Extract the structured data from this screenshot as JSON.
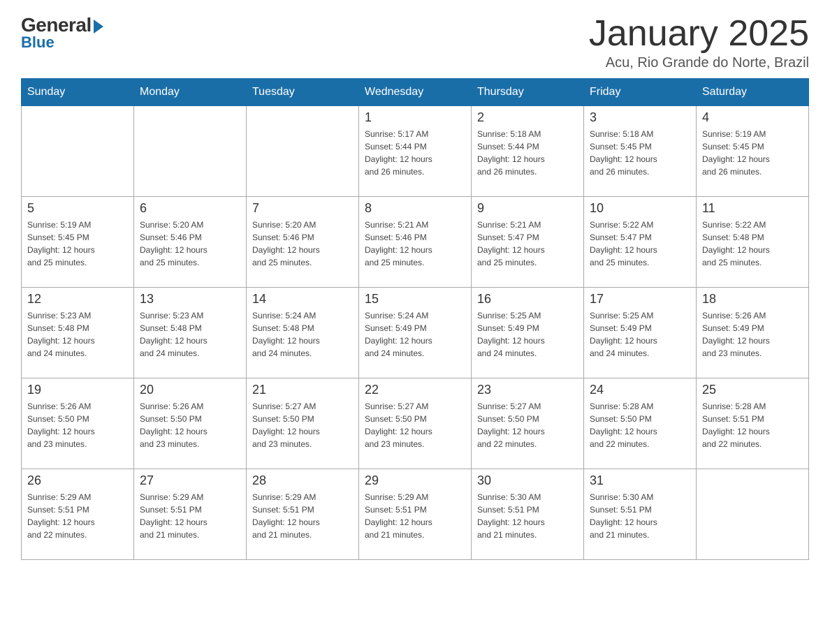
{
  "logo": {
    "general": "General",
    "blue": "Blue"
  },
  "header": {
    "month": "January 2025",
    "location": "Acu, Rio Grande do Norte, Brazil"
  },
  "days_of_week": [
    "Sunday",
    "Monday",
    "Tuesday",
    "Wednesday",
    "Thursday",
    "Friday",
    "Saturday"
  ],
  "weeks": [
    [
      {
        "day": "",
        "info": ""
      },
      {
        "day": "",
        "info": ""
      },
      {
        "day": "",
        "info": ""
      },
      {
        "day": "1",
        "info": "Sunrise: 5:17 AM\nSunset: 5:44 PM\nDaylight: 12 hours\nand 26 minutes."
      },
      {
        "day": "2",
        "info": "Sunrise: 5:18 AM\nSunset: 5:44 PM\nDaylight: 12 hours\nand 26 minutes."
      },
      {
        "day": "3",
        "info": "Sunrise: 5:18 AM\nSunset: 5:45 PM\nDaylight: 12 hours\nand 26 minutes."
      },
      {
        "day": "4",
        "info": "Sunrise: 5:19 AM\nSunset: 5:45 PM\nDaylight: 12 hours\nand 26 minutes."
      }
    ],
    [
      {
        "day": "5",
        "info": "Sunrise: 5:19 AM\nSunset: 5:45 PM\nDaylight: 12 hours\nand 25 minutes."
      },
      {
        "day": "6",
        "info": "Sunrise: 5:20 AM\nSunset: 5:46 PM\nDaylight: 12 hours\nand 25 minutes."
      },
      {
        "day": "7",
        "info": "Sunrise: 5:20 AM\nSunset: 5:46 PM\nDaylight: 12 hours\nand 25 minutes."
      },
      {
        "day": "8",
        "info": "Sunrise: 5:21 AM\nSunset: 5:46 PM\nDaylight: 12 hours\nand 25 minutes."
      },
      {
        "day": "9",
        "info": "Sunrise: 5:21 AM\nSunset: 5:47 PM\nDaylight: 12 hours\nand 25 minutes."
      },
      {
        "day": "10",
        "info": "Sunrise: 5:22 AM\nSunset: 5:47 PM\nDaylight: 12 hours\nand 25 minutes."
      },
      {
        "day": "11",
        "info": "Sunrise: 5:22 AM\nSunset: 5:48 PM\nDaylight: 12 hours\nand 25 minutes."
      }
    ],
    [
      {
        "day": "12",
        "info": "Sunrise: 5:23 AM\nSunset: 5:48 PM\nDaylight: 12 hours\nand 24 minutes."
      },
      {
        "day": "13",
        "info": "Sunrise: 5:23 AM\nSunset: 5:48 PM\nDaylight: 12 hours\nand 24 minutes."
      },
      {
        "day": "14",
        "info": "Sunrise: 5:24 AM\nSunset: 5:48 PM\nDaylight: 12 hours\nand 24 minutes."
      },
      {
        "day": "15",
        "info": "Sunrise: 5:24 AM\nSunset: 5:49 PM\nDaylight: 12 hours\nand 24 minutes."
      },
      {
        "day": "16",
        "info": "Sunrise: 5:25 AM\nSunset: 5:49 PM\nDaylight: 12 hours\nand 24 minutes."
      },
      {
        "day": "17",
        "info": "Sunrise: 5:25 AM\nSunset: 5:49 PM\nDaylight: 12 hours\nand 24 minutes."
      },
      {
        "day": "18",
        "info": "Sunrise: 5:26 AM\nSunset: 5:49 PM\nDaylight: 12 hours\nand 23 minutes."
      }
    ],
    [
      {
        "day": "19",
        "info": "Sunrise: 5:26 AM\nSunset: 5:50 PM\nDaylight: 12 hours\nand 23 minutes."
      },
      {
        "day": "20",
        "info": "Sunrise: 5:26 AM\nSunset: 5:50 PM\nDaylight: 12 hours\nand 23 minutes."
      },
      {
        "day": "21",
        "info": "Sunrise: 5:27 AM\nSunset: 5:50 PM\nDaylight: 12 hours\nand 23 minutes."
      },
      {
        "day": "22",
        "info": "Sunrise: 5:27 AM\nSunset: 5:50 PM\nDaylight: 12 hours\nand 23 minutes."
      },
      {
        "day": "23",
        "info": "Sunrise: 5:27 AM\nSunset: 5:50 PM\nDaylight: 12 hours\nand 22 minutes."
      },
      {
        "day": "24",
        "info": "Sunrise: 5:28 AM\nSunset: 5:50 PM\nDaylight: 12 hours\nand 22 minutes."
      },
      {
        "day": "25",
        "info": "Sunrise: 5:28 AM\nSunset: 5:51 PM\nDaylight: 12 hours\nand 22 minutes."
      }
    ],
    [
      {
        "day": "26",
        "info": "Sunrise: 5:29 AM\nSunset: 5:51 PM\nDaylight: 12 hours\nand 22 minutes."
      },
      {
        "day": "27",
        "info": "Sunrise: 5:29 AM\nSunset: 5:51 PM\nDaylight: 12 hours\nand 21 minutes."
      },
      {
        "day": "28",
        "info": "Sunrise: 5:29 AM\nSunset: 5:51 PM\nDaylight: 12 hours\nand 21 minutes."
      },
      {
        "day": "29",
        "info": "Sunrise: 5:29 AM\nSunset: 5:51 PM\nDaylight: 12 hours\nand 21 minutes."
      },
      {
        "day": "30",
        "info": "Sunrise: 5:30 AM\nSunset: 5:51 PM\nDaylight: 12 hours\nand 21 minutes."
      },
      {
        "day": "31",
        "info": "Sunrise: 5:30 AM\nSunset: 5:51 PM\nDaylight: 12 hours\nand 21 minutes."
      },
      {
        "day": "",
        "info": ""
      }
    ]
  ]
}
